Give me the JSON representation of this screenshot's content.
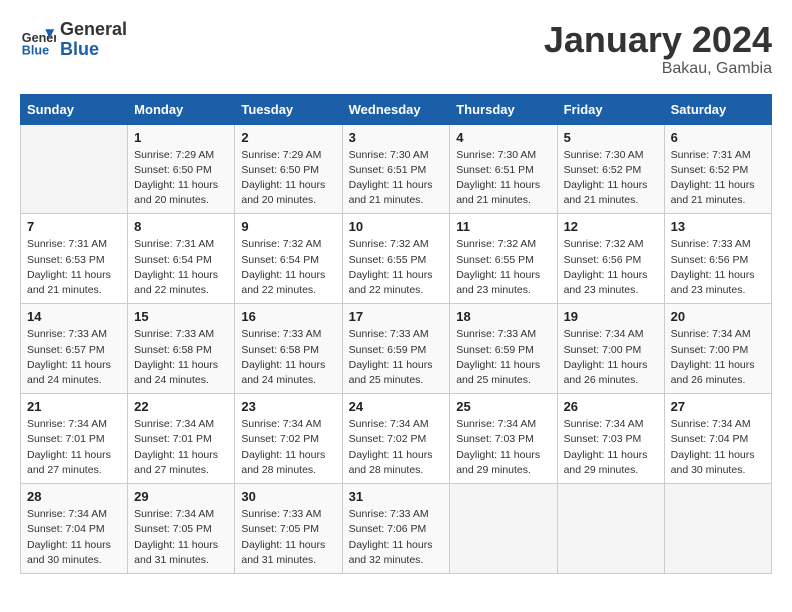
{
  "header": {
    "logo_line1": "General",
    "logo_line2": "Blue",
    "month": "January 2024",
    "location": "Bakau, Gambia"
  },
  "weekdays": [
    "Sunday",
    "Monday",
    "Tuesday",
    "Wednesday",
    "Thursday",
    "Friday",
    "Saturday"
  ],
  "weeks": [
    [
      {
        "day": "",
        "info": ""
      },
      {
        "day": "1",
        "info": "Sunrise: 7:29 AM\nSunset: 6:50 PM\nDaylight: 11 hours\nand 20 minutes."
      },
      {
        "day": "2",
        "info": "Sunrise: 7:29 AM\nSunset: 6:50 PM\nDaylight: 11 hours\nand 20 minutes."
      },
      {
        "day": "3",
        "info": "Sunrise: 7:30 AM\nSunset: 6:51 PM\nDaylight: 11 hours\nand 21 minutes."
      },
      {
        "day": "4",
        "info": "Sunrise: 7:30 AM\nSunset: 6:51 PM\nDaylight: 11 hours\nand 21 minutes."
      },
      {
        "day": "5",
        "info": "Sunrise: 7:30 AM\nSunset: 6:52 PM\nDaylight: 11 hours\nand 21 minutes."
      },
      {
        "day": "6",
        "info": "Sunrise: 7:31 AM\nSunset: 6:52 PM\nDaylight: 11 hours\nand 21 minutes."
      }
    ],
    [
      {
        "day": "7",
        "info": "Sunrise: 7:31 AM\nSunset: 6:53 PM\nDaylight: 11 hours\nand 21 minutes."
      },
      {
        "day": "8",
        "info": "Sunrise: 7:31 AM\nSunset: 6:54 PM\nDaylight: 11 hours\nand 22 minutes."
      },
      {
        "day": "9",
        "info": "Sunrise: 7:32 AM\nSunset: 6:54 PM\nDaylight: 11 hours\nand 22 minutes."
      },
      {
        "day": "10",
        "info": "Sunrise: 7:32 AM\nSunset: 6:55 PM\nDaylight: 11 hours\nand 22 minutes."
      },
      {
        "day": "11",
        "info": "Sunrise: 7:32 AM\nSunset: 6:55 PM\nDaylight: 11 hours\nand 23 minutes."
      },
      {
        "day": "12",
        "info": "Sunrise: 7:32 AM\nSunset: 6:56 PM\nDaylight: 11 hours\nand 23 minutes."
      },
      {
        "day": "13",
        "info": "Sunrise: 7:33 AM\nSunset: 6:56 PM\nDaylight: 11 hours\nand 23 minutes."
      }
    ],
    [
      {
        "day": "14",
        "info": "Sunrise: 7:33 AM\nSunset: 6:57 PM\nDaylight: 11 hours\nand 24 minutes."
      },
      {
        "day": "15",
        "info": "Sunrise: 7:33 AM\nSunset: 6:58 PM\nDaylight: 11 hours\nand 24 minutes."
      },
      {
        "day": "16",
        "info": "Sunrise: 7:33 AM\nSunset: 6:58 PM\nDaylight: 11 hours\nand 24 minutes."
      },
      {
        "day": "17",
        "info": "Sunrise: 7:33 AM\nSunset: 6:59 PM\nDaylight: 11 hours\nand 25 minutes."
      },
      {
        "day": "18",
        "info": "Sunrise: 7:33 AM\nSunset: 6:59 PM\nDaylight: 11 hours\nand 25 minutes."
      },
      {
        "day": "19",
        "info": "Sunrise: 7:34 AM\nSunset: 7:00 PM\nDaylight: 11 hours\nand 26 minutes."
      },
      {
        "day": "20",
        "info": "Sunrise: 7:34 AM\nSunset: 7:00 PM\nDaylight: 11 hours\nand 26 minutes."
      }
    ],
    [
      {
        "day": "21",
        "info": "Sunrise: 7:34 AM\nSunset: 7:01 PM\nDaylight: 11 hours\nand 27 minutes."
      },
      {
        "day": "22",
        "info": "Sunrise: 7:34 AM\nSunset: 7:01 PM\nDaylight: 11 hours\nand 27 minutes."
      },
      {
        "day": "23",
        "info": "Sunrise: 7:34 AM\nSunset: 7:02 PM\nDaylight: 11 hours\nand 28 minutes."
      },
      {
        "day": "24",
        "info": "Sunrise: 7:34 AM\nSunset: 7:02 PM\nDaylight: 11 hours\nand 28 minutes."
      },
      {
        "day": "25",
        "info": "Sunrise: 7:34 AM\nSunset: 7:03 PM\nDaylight: 11 hours\nand 29 minutes."
      },
      {
        "day": "26",
        "info": "Sunrise: 7:34 AM\nSunset: 7:03 PM\nDaylight: 11 hours\nand 29 minutes."
      },
      {
        "day": "27",
        "info": "Sunrise: 7:34 AM\nSunset: 7:04 PM\nDaylight: 11 hours\nand 30 minutes."
      }
    ],
    [
      {
        "day": "28",
        "info": "Sunrise: 7:34 AM\nSunset: 7:04 PM\nDaylight: 11 hours\nand 30 minutes."
      },
      {
        "day": "29",
        "info": "Sunrise: 7:34 AM\nSunset: 7:05 PM\nDaylight: 11 hours\nand 31 minutes."
      },
      {
        "day": "30",
        "info": "Sunrise: 7:33 AM\nSunset: 7:05 PM\nDaylight: 11 hours\nand 31 minutes."
      },
      {
        "day": "31",
        "info": "Sunrise: 7:33 AM\nSunset: 7:06 PM\nDaylight: 11 hours\nand 32 minutes."
      },
      {
        "day": "",
        "info": ""
      },
      {
        "day": "",
        "info": ""
      },
      {
        "day": "",
        "info": ""
      }
    ]
  ]
}
